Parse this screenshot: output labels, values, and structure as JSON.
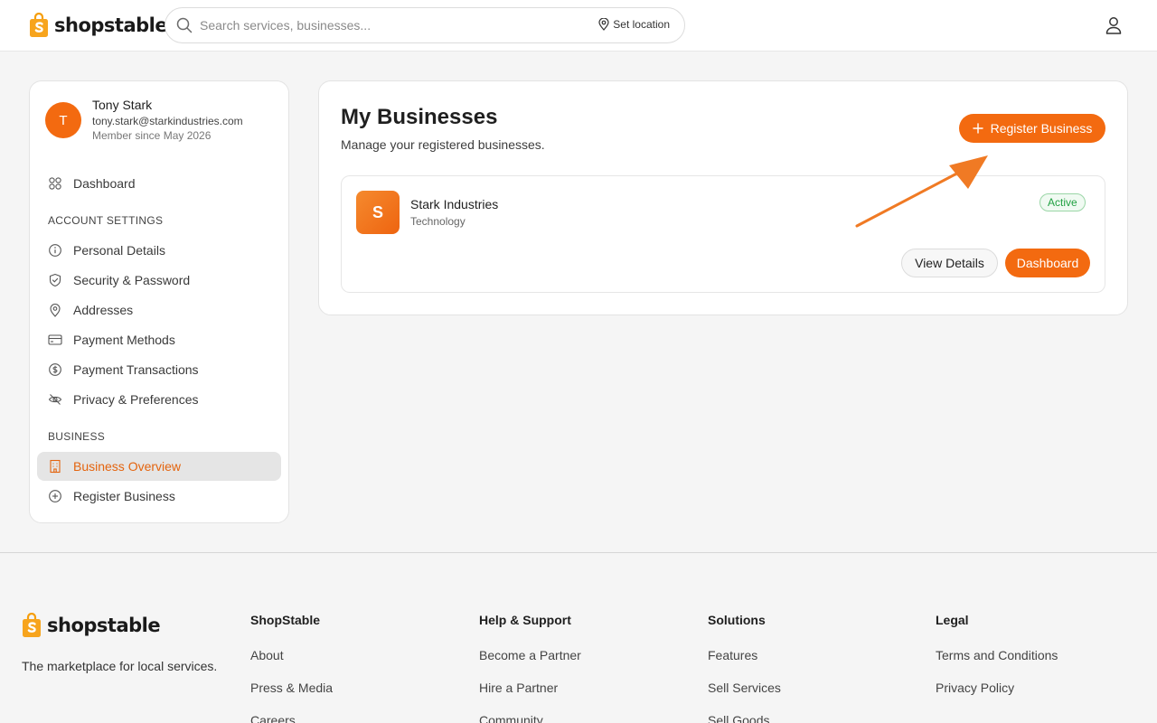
{
  "brand": {
    "name": "shopstable",
    "accent": "#f36a10"
  },
  "header": {
    "search_placeholder": "Search services, businesses...",
    "location_label": "Set location"
  },
  "profile": {
    "initial": "T",
    "name": "Tony Stark",
    "email": "tony.stark@starkindustries.com",
    "member_since": "Member since May 2026"
  },
  "sidebar": {
    "dashboard": "Dashboard",
    "account_settings_title": "ACCOUNT SETTINGS",
    "account_items": [
      {
        "label": "Personal Details",
        "icon": "info-icon"
      },
      {
        "label": "Security & Password",
        "icon": "shield-icon"
      },
      {
        "label": "Addresses",
        "icon": "map-pin-icon"
      },
      {
        "label": "Payment Methods",
        "icon": "credit-card-icon"
      },
      {
        "label": "Payment Transactions",
        "icon": "dollar-icon"
      },
      {
        "label": "Privacy & Preferences",
        "icon": "eye-off-icon"
      }
    ],
    "business_title": "BUSINESS",
    "business_items": [
      {
        "label": "Business Overview",
        "icon": "building-icon",
        "active": true
      },
      {
        "label": "Register Business",
        "icon": "plus-circle-icon",
        "active": false
      }
    ]
  },
  "main": {
    "title": "My Businesses",
    "subtitle": "Manage your registered businesses.",
    "register_button": "Register Business",
    "business": {
      "initial": "S",
      "name": "Stark Industries",
      "category": "Technology",
      "status": "Active",
      "view_button": "View Details",
      "dashboard_button": "Dashboard"
    }
  },
  "footer": {
    "tagline": "The marketplace for local services.",
    "columns": [
      {
        "title": "ShopStable",
        "links": [
          "About",
          "Press & Media",
          "Careers"
        ]
      },
      {
        "title": "Help & Support",
        "links": [
          "Become a Partner",
          "Hire a Partner",
          "Community"
        ]
      },
      {
        "title": "Solutions",
        "links": [
          "Features",
          "Sell Services",
          "Sell Goods"
        ]
      },
      {
        "title": "Legal",
        "links": [
          "Terms and Conditions",
          "Privacy Policy"
        ]
      }
    ]
  }
}
